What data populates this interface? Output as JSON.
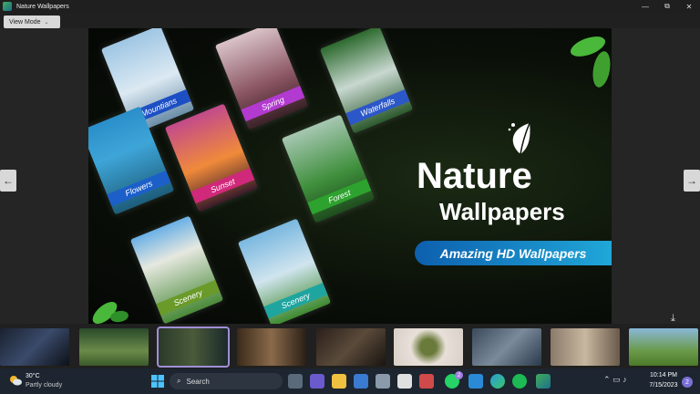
{
  "window": {
    "title": "Nature Wallpapers",
    "controls": [
      "—",
      "⧉",
      "✕"
    ]
  },
  "toolbar": {
    "view_mode_label": "View Mode"
  },
  "viewer": {
    "prev_icon": "arrow-left-icon",
    "next_icon": "arrow-right-icon",
    "image": {
      "title_line1": "Nature",
      "title_line2": "Wallpapers",
      "banner": "Amazing HD Wallpapers",
      "cards": [
        "Mountians",
        "Spring",
        "Waterfalls",
        "Flowers",
        "Sunset",
        "Forest",
        "Scenery",
        "Scenery"
      ]
    }
  },
  "thumbnails": {
    "count": 9,
    "selected_index": 2,
    "download_icon": "download-icon"
  },
  "taskbar": {
    "weather_temp": "30°C",
    "weather_desc": "Partly cloudy",
    "search_placeholder": "Search",
    "whatsapp_badge": "2",
    "time": "10:14 PM",
    "date": "7/15/2023",
    "notification_count": "2"
  },
  "colors": {
    "accent": "#a08fd6",
    "banner": "#20a7d8",
    "taskbar": "#1c2530"
  }
}
